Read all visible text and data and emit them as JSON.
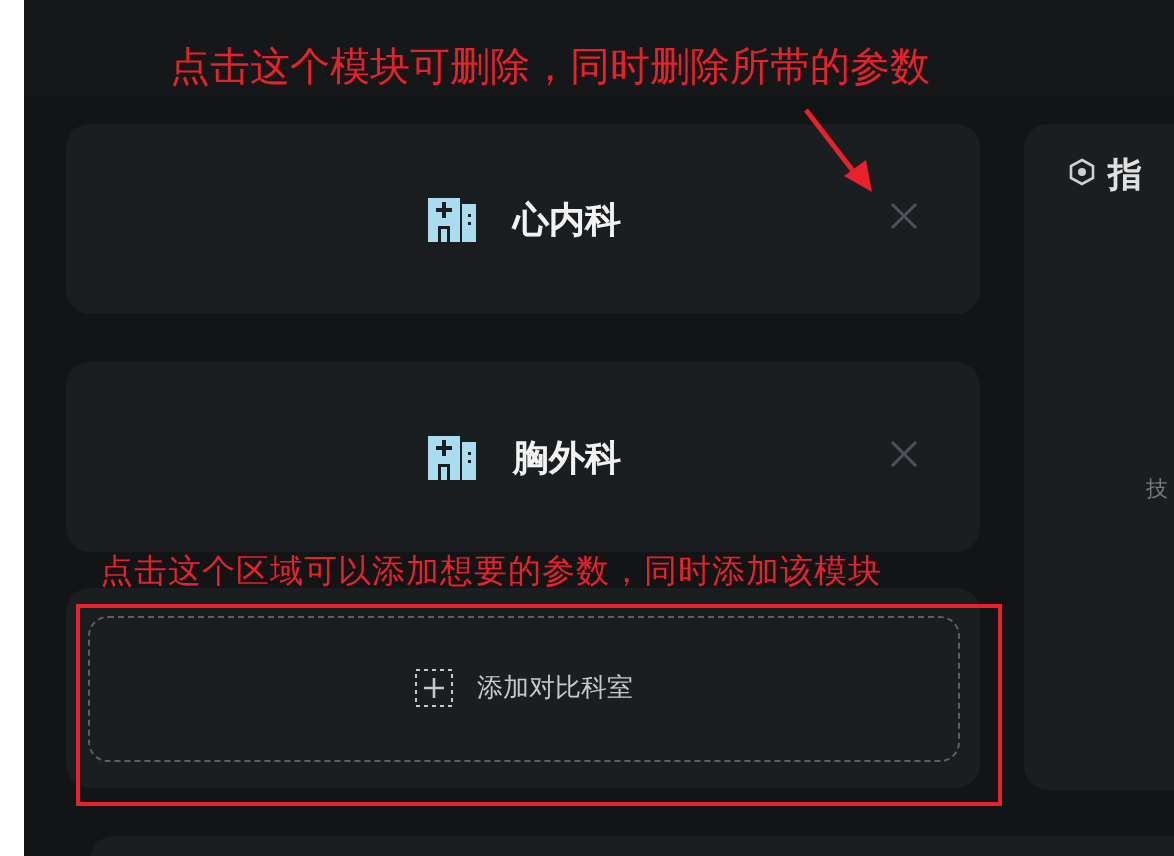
{
  "annotations": [
    {
      "text": "点击这个模块可删除，同时删除所带的参数"
    },
    {
      "text": "点击这个区域可以添加想要的参数，同时添加该模块"
    }
  ],
  "departments": [
    {
      "name": "心内科"
    },
    {
      "name": "胸外科"
    }
  ],
  "add_button": {
    "label": "添加对比科室"
  },
  "side_panel": {
    "title": "指",
    "body": "技"
  }
}
